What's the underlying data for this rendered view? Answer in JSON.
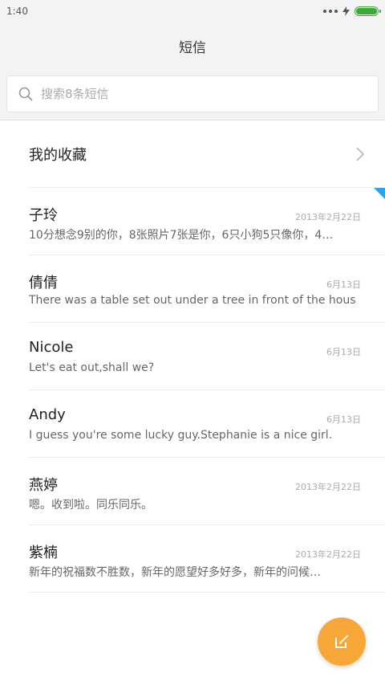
{
  "status_bar": {
    "time": "1:40"
  },
  "header": {
    "title": "短信"
  },
  "search": {
    "placeholder": "搜索8条短信"
  },
  "favorites": {
    "label": "我的收藏"
  },
  "conversations": [
    {
      "name": "子玲",
      "date": "2013年2月22日",
      "preview": "10分想念9别的你，8张照片7张是你，6只小狗5只像你，4…",
      "unread": true
    },
    {
      "name": "倩倩",
      "date": "6月13日",
      "preview": "There was a table set out under a tree in front of the hous"
    },
    {
      "name": "Nicole",
      "date": "6月13日",
      "preview": "Let's eat out,shall we?"
    },
    {
      "name": "Andy",
      "date": "6月13日",
      "preview": "I guess you're some lucky guy.Stephanie is a nice girl."
    },
    {
      "name": "燕婷",
      "date": "2013年2月22日",
      "preview": "嗯。收到啦。同乐同乐。"
    },
    {
      "name": "紫楠",
      "date": "2013年2月22日",
      "preview": "新年的祝福数不胜数，新年的愿望好多好多，新年的问候…"
    }
  ],
  "colors": {
    "accent": "#f7a737",
    "unread": "#29a6e8",
    "battery": "#3aaa35"
  },
  "icons": {
    "search": "search-icon",
    "chevron": "chevron-right-icon",
    "compose": "compose-icon"
  }
}
